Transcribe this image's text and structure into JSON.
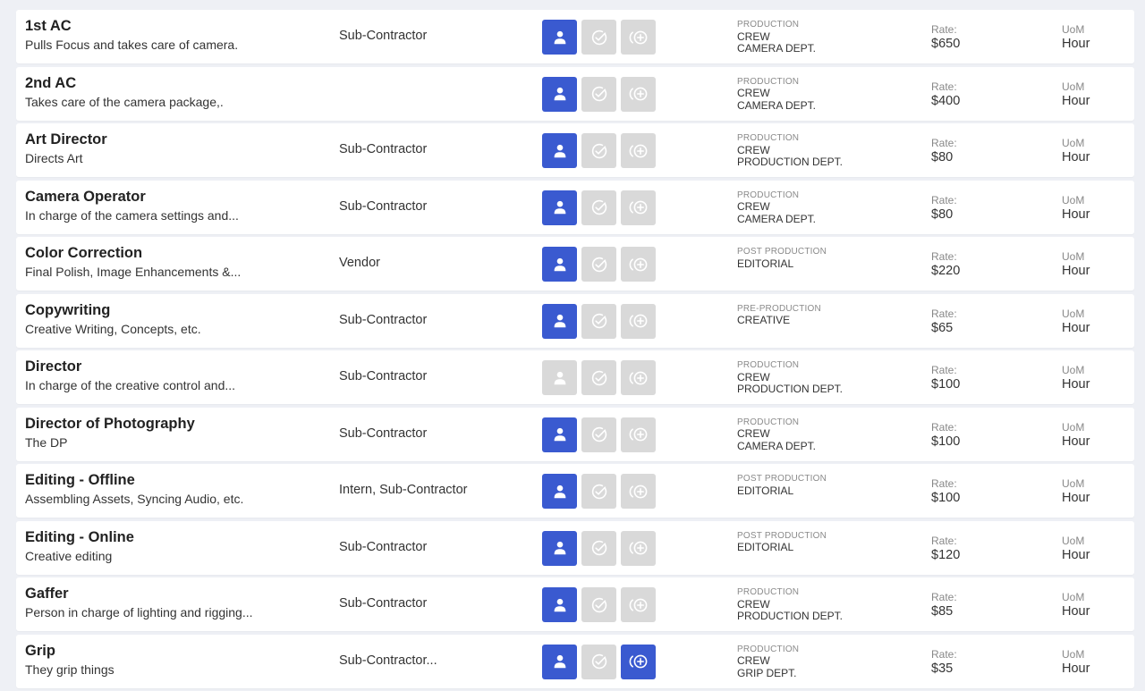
{
  "labels": {
    "rate": "Rate:",
    "uom": "UoM"
  },
  "colors": {
    "active": "#3a5ad0",
    "inactive": "#d9d9d9"
  },
  "rows": [
    {
      "name": "1st AC",
      "description": "Pulls Focus and takes care of camera.",
      "type": "Sub-Contractor",
      "categories": {
        "group": "PRODUCTION",
        "lines": [
          "CREW",
          "CAMERA DEPT."
        ]
      },
      "rate": "$650",
      "uom": "Hour",
      "assign_active": true,
      "check_active": false,
      "add_active": false
    },
    {
      "name": "2nd AC",
      "description": "Takes care of the camera package,.",
      "type": "",
      "categories": {
        "group": "PRODUCTION",
        "lines": [
          "CREW",
          "CAMERA DEPT."
        ]
      },
      "rate": "$400",
      "uom": "Hour",
      "assign_active": true,
      "check_active": false,
      "add_active": false
    },
    {
      "name": "Art Director",
      "description": "Directs Art",
      "type": "Sub-Contractor",
      "categories": {
        "group": "PRODUCTION",
        "lines": [
          "CREW",
          "PRODUCTION DEPT."
        ]
      },
      "rate": "$80",
      "uom": "Hour",
      "assign_active": true,
      "check_active": false,
      "add_active": false
    },
    {
      "name": "Camera Operator",
      "description": "In charge of the camera settings and...",
      "type": "Sub-Contractor",
      "categories": {
        "group": "PRODUCTION",
        "lines": [
          "CREW",
          "CAMERA DEPT."
        ]
      },
      "rate": "$80",
      "uom": "Hour",
      "assign_active": true,
      "check_active": false,
      "add_active": false
    },
    {
      "name": "Color Correction",
      "description": "Final Polish, Image Enhancements &...",
      "type": "Vendor",
      "categories": {
        "group": "POST PRODUCTION",
        "lines": [
          "EDITORIAL"
        ]
      },
      "rate": "$220",
      "uom": "Hour",
      "assign_active": true,
      "check_active": false,
      "add_active": false
    },
    {
      "name": "Copywriting",
      "description": "Creative Writing, Concepts, etc.",
      "type": "Sub-Contractor",
      "categories": {
        "group": "PRE-PRODUCTION",
        "lines": [
          "CREATIVE"
        ]
      },
      "rate": "$65",
      "uom": "Hour",
      "assign_active": true,
      "check_active": false,
      "add_active": false
    },
    {
      "name": "Director",
      "description": "In charge of the creative control and...",
      "type": "Sub-Contractor",
      "categories": {
        "group": "PRODUCTION",
        "lines": [
          "CREW",
          "PRODUCTION DEPT."
        ]
      },
      "rate": "$100",
      "uom": "Hour",
      "assign_active": false,
      "check_active": false,
      "add_active": false
    },
    {
      "name": "Director of Photography",
      "description": "The DP",
      "type": "Sub-Contractor",
      "categories": {
        "group": "PRODUCTION",
        "lines": [
          "CREW",
          "CAMERA DEPT."
        ]
      },
      "rate": "$100",
      "uom": "Hour",
      "assign_active": true,
      "check_active": false,
      "add_active": false
    },
    {
      "name": "Editing - Offline",
      "description": "Assembling Assets, Syncing Audio, etc.",
      "type": "Intern, Sub-Contractor",
      "categories": {
        "group": "POST PRODUCTION",
        "lines": [
          "EDITORIAL"
        ]
      },
      "rate": "$100",
      "uom": "Hour",
      "assign_active": true,
      "check_active": false,
      "add_active": false
    },
    {
      "name": "Editing - Online",
      "description": "Creative editing",
      "type": "Sub-Contractor",
      "categories": {
        "group": "POST PRODUCTION",
        "lines": [
          "EDITORIAL"
        ]
      },
      "rate": "$120",
      "uom": "Hour",
      "assign_active": true,
      "check_active": false,
      "add_active": false
    },
    {
      "name": "Gaffer",
      "description": "Person in charge of lighting and rigging...",
      "type": "Sub-Contractor",
      "categories": {
        "group": "PRODUCTION",
        "lines": [
          "CREW",
          "PRODUCTION DEPT."
        ]
      },
      "rate": "$85",
      "uom": "Hour",
      "assign_active": true,
      "check_active": false,
      "add_active": false
    },
    {
      "name": "Grip",
      "description": "They grip things",
      "type": "Sub-Contractor...",
      "categories": {
        "group": "PRODUCTION",
        "lines": [
          "CREW",
          "GRIP DEPT."
        ]
      },
      "rate": "$35",
      "uom": "Hour",
      "assign_active": true,
      "check_active": false,
      "add_active": true
    }
  ]
}
